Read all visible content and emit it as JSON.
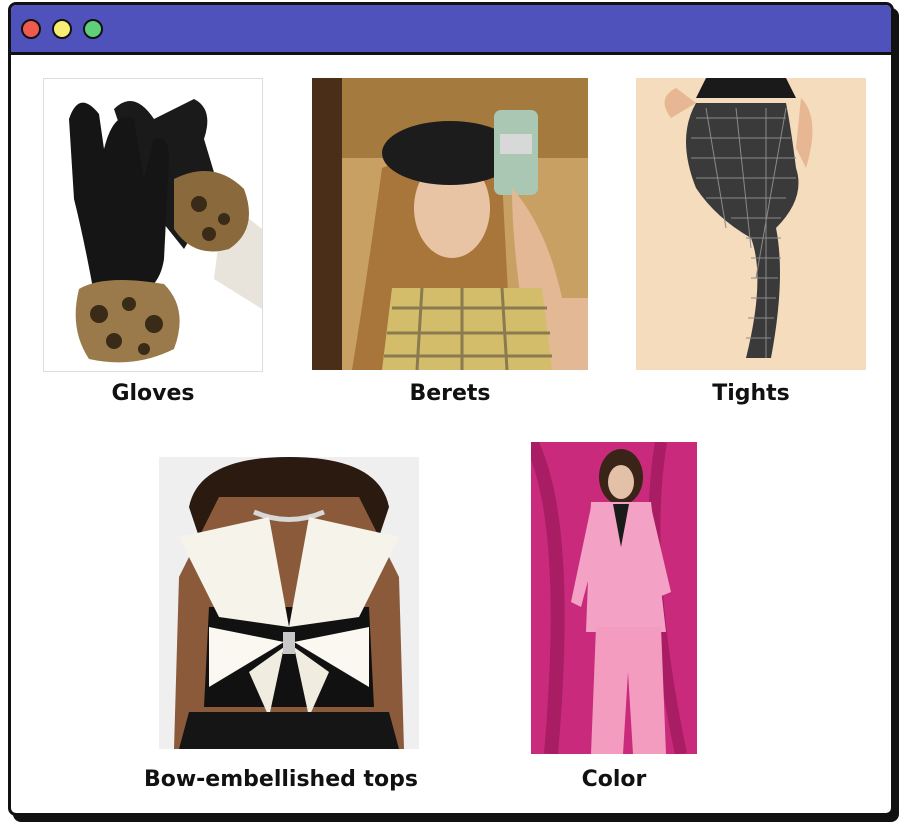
{
  "window": {
    "titlebar_color": "#4f52bb",
    "controls": [
      {
        "name": "close",
        "color": "#ef5a4f"
      },
      {
        "name": "minimize",
        "color": "#f7ec74"
      },
      {
        "name": "maximize",
        "color": "#5fd07a"
      }
    ]
  },
  "items": [
    {
      "label": "Gloves",
      "image": "black leather gloves with leopard faux-fur cuffs"
    },
    {
      "label": "Berets",
      "image": "mirror selfie of woman wearing black beret and plaid top"
    },
    {
      "label": "Tights",
      "image": "model in black patterned fishnet tights"
    },
    {
      "label": "Bow-embellished tops",
      "image": "white satin bow-embellished crop top"
    },
    {
      "label": "Color",
      "image": "model in pink suit against magenta backdrop"
    }
  ]
}
